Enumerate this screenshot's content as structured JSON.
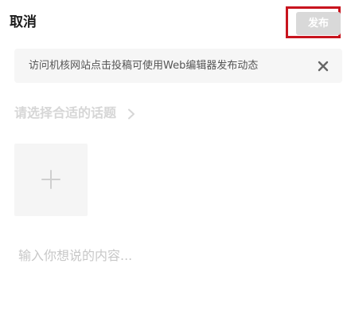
{
  "header": {
    "cancel_label": "取消",
    "publish_label": "发布"
  },
  "notice": {
    "text": "访问机核网站点击投稿可使用Web编辑器发布动态",
    "close_icon": "close-icon"
  },
  "topic": {
    "label": "请选择合适的话题",
    "chevron_icon": "chevron-right-icon"
  },
  "media": {
    "add_icon": "plus-icon"
  },
  "content": {
    "value": "",
    "placeholder": "输入你想说的内容..."
  },
  "colors": {
    "publish_disabled_bg": "#d9d9d9",
    "highlight_frame": "#c8141e",
    "notice_bg": "#f6f6f6",
    "muted_text": "#d6d6d6"
  }
}
